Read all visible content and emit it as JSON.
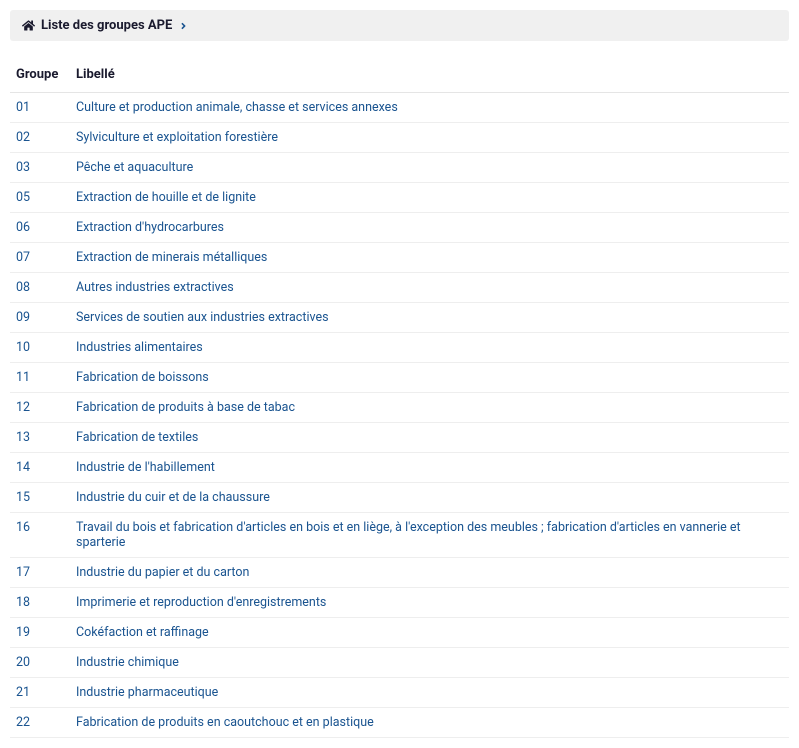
{
  "breadcrumb": {
    "title": "Liste des groupes APE"
  },
  "table": {
    "headers": {
      "groupe": "Groupe",
      "libelle": "Libellé"
    },
    "rows": [
      {
        "code": "01",
        "label": "Culture et production animale, chasse et services annexes"
      },
      {
        "code": "02",
        "label": "Sylviculture et exploitation forestière"
      },
      {
        "code": "03",
        "label": "Pêche et aquaculture"
      },
      {
        "code": "05",
        "label": "Extraction de houille et de lignite"
      },
      {
        "code": "06",
        "label": "Extraction d'hydrocarbures"
      },
      {
        "code": "07",
        "label": "Extraction de minerais métalliques"
      },
      {
        "code": "08",
        "label": "Autres industries extractives"
      },
      {
        "code": "09",
        "label": "Services de soutien aux industries extractives"
      },
      {
        "code": "10",
        "label": "Industries alimentaires"
      },
      {
        "code": "11",
        "label": "Fabrication de boissons"
      },
      {
        "code": "12",
        "label": "Fabrication de produits à base de tabac"
      },
      {
        "code": "13",
        "label": "Fabrication de textiles"
      },
      {
        "code": "14",
        "label": "Industrie de l'habillement"
      },
      {
        "code": "15",
        "label": "Industrie du cuir et de la chaussure"
      },
      {
        "code": "16",
        "label": "Travail du bois et fabrication d'articles en bois et en liège, à l'exception des meubles ; fabrication d'articles en vannerie et sparterie"
      },
      {
        "code": "17",
        "label": "Industrie du papier et du carton"
      },
      {
        "code": "18",
        "label": "Imprimerie et reproduction d'enregistrements"
      },
      {
        "code": "19",
        "label": "Cokéfaction et raffinage"
      },
      {
        "code": "20",
        "label": "Industrie chimique"
      },
      {
        "code": "21",
        "label": "Industrie pharmaceutique"
      },
      {
        "code": "22",
        "label": "Fabrication de produits en caoutchouc et en plastique"
      }
    ]
  }
}
